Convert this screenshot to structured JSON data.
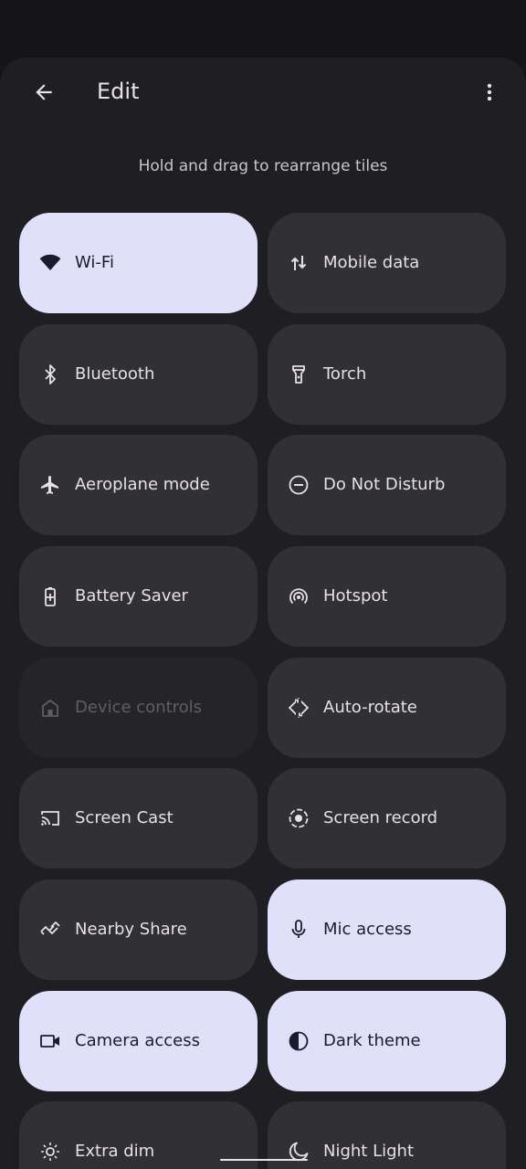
{
  "toolbar": {
    "title": "Edit",
    "back_icon": "arrow-back-icon",
    "more_icon": "more-vert-icon"
  },
  "hint": "Hold and drag to rearrange tiles",
  "colors": {
    "sheet_bg": "#1f1f23",
    "tile_off": "#313034",
    "tile_on": "#e0e0fb",
    "tile_unavailable": "#252528"
  },
  "tiles": [
    {
      "label": "Wi-Fi",
      "icon": "wifi-icon",
      "state": "on"
    },
    {
      "label": "Mobile data",
      "icon": "mobile-data-icon",
      "state": "off"
    },
    {
      "label": "Bluetooth",
      "icon": "bluetooth-icon",
      "state": "off"
    },
    {
      "label": "Torch",
      "icon": "torch-icon",
      "state": "off"
    },
    {
      "label": "Aeroplane mode",
      "icon": "airplane-icon",
      "state": "off"
    },
    {
      "label": "Do Not Disturb",
      "icon": "do-not-disturb-icon",
      "state": "off"
    },
    {
      "label": "Battery Saver",
      "icon": "battery-saver-icon",
      "state": "off"
    },
    {
      "label": "Hotspot",
      "icon": "hotspot-icon",
      "state": "off"
    },
    {
      "label": "Device controls",
      "icon": "home-icon",
      "state": "unavailable"
    },
    {
      "label": "Auto-rotate",
      "icon": "auto-rotate-icon",
      "state": "off"
    },
    {
      "label": "Screen Cast",
      "icon": "cast-icon",
      "state": "off"
    },
    {
      "label": "Screen record",
      "icon": "screen-record-icon",
      "state": "off"
    },
    {
      "label": "Nearby Share",
      "icon": "nearby-share-icon",
      "state": "off"
    },
    {
      "label": "Mic access",
      "icon": "mic-icon",
      "state": "on"
    },
    {
      "label": "Camera access",
      "icon": "camera-icon",
      "state": "on"
    },
    {
      "label": "Dark theme",
      "icon": "dark-theme-icon",
      "state": "on"
    },
    {
      "label": "Extra dim",
      "icon": "extra-dim-icon",
      "state": "off"
    },
    {
      "label": "Night Light",
      "icon": "night-light-icon",
      "state": "off"
    }
  ]
}
